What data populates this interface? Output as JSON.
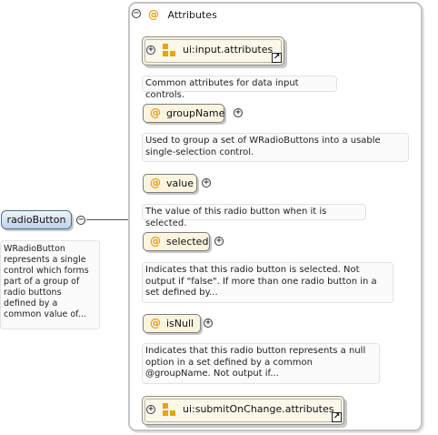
{
  "root": {
    "name": "radioButton",
    "toggle": "−",
    "description": "WRadioButton represents a single control which forms part of a group of radio buttons defined by a common value of..."
  },
  "group": {
    "toggle": "−",
    "at": "@",
    "title": "Attributes"
  },
  "refs": [
    {
      "toggle": "+",
      "label": "ui:input.attributes",
      "link": "↗"
    },
    {
      "toggle": "+",
      "label": "ui:submitOnChange.attributes",
      "link": "↗"
    }
  ],
  "ref_desc": "Common attributes for data input controls.",
  "attributes": [
    {
      "at": "@",
      "name": "groupName",
      "toggle": "+",
      "description": "Used to group a set of WRadioButtons into a usable single-selection control."
    },
    {
      "at": "@",
      "name": "value",
      "toggle": "+",
      "description": "The value of this radio button when it is selected."
    },
    {
      "at": "@",
      "name": "selected",
      "toggle": "+",
      "description": "Indicates that this radio button is selected. Not output if \"false\". If more than one radio button in a set defined by..."
    },
    {
      "at": "@",
      "name": "isNull",
      "toggle": "+",
      "description": "Indicates that this radio button represents a null option in a set defined by a common @groupName. Not output if..."
    }
  ],
  "colors": {
    "root_fill": "#bfd2e8",
    "attr_fill": "#fbf5e0",
    "ref_fill": "#f6f1d8",
    "at_symbol": "#e69a1e"
  }
}
